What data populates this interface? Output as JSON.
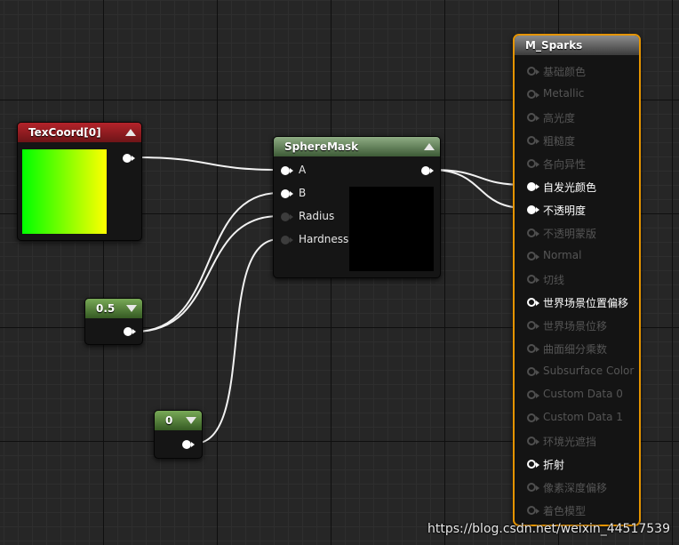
{
  "nodes": {
    "texcoord": {
      "title": "TexCoord[0]"
    },
    "spheremask": {
      "title": "SphereMask",
      "inputs": [
        "A",
        "B",
        "Radius",
        "Hardness"
      ]
    },
    "const_half": {
      "value": "0.5"
    },
    "const_zero": {
      "value": "0"
    },
    "material": {
      "title": "M_Sparks",
      "outputs": [
        {
          "label": "基础颜色",
          "state": "dim"
        },
        {
          "label": "Metallic",
          "state": "dim"
        },
        {
          "label": "高光度",
          "state": "dim"
        },
        {
          "label": "粗糙度",
          "state": "dim"
        },
        {
          "label": "各向异性",
          "state": "dim"
        },
        {
          "label": "自发光颜色",
          "state": "connected"
        },
        {
          "label": "不透明度",
          "state": "connected"
        },
        {
          "label": "不透明蒙版",
          "state": "dim"
        },
        {
          "label": "Normal",
          "state": "dim"
        },
        {
          "label": "切线",
          "state": "dim"
        },
        {
          "label": "世界场景位置偏移",
          "state": "active"
        },
        {
          "label": "世界场景位移",
          "state": "dim"
        },
        {
          "label": "曲面细分乘数",
          "state": "dim"
        },
        {
          "label": "Subsurface Color",
          "state": "dim"
        },
        {
          "label": "Custom Data 0",
          "state": "dim"
        },
        {
          "label": "Custom Data 1",
          "state": "dim"
        },
        {
          "label": "环境光遮挡",
          "state": "dim"
        },
        {
          "label": "折射",
          "state": "active"
        },
        {
          "label": "像素深度偏移",
          "state": "dim"
        },
        {
          "label": "着色模型",
          "state": "dim"
        }
      ]
    }
  },
  "watermark": "https://blog.csdn.net/weixin_44517539",
  "colors": {
    "texcoord_header": "#b4232a",
    "spheremask_header": "#8fad84",
    "constant_header": "#79aa57",
    "selection_outline": "#e59400",
    "wire": "#ffffff"
  }
}
